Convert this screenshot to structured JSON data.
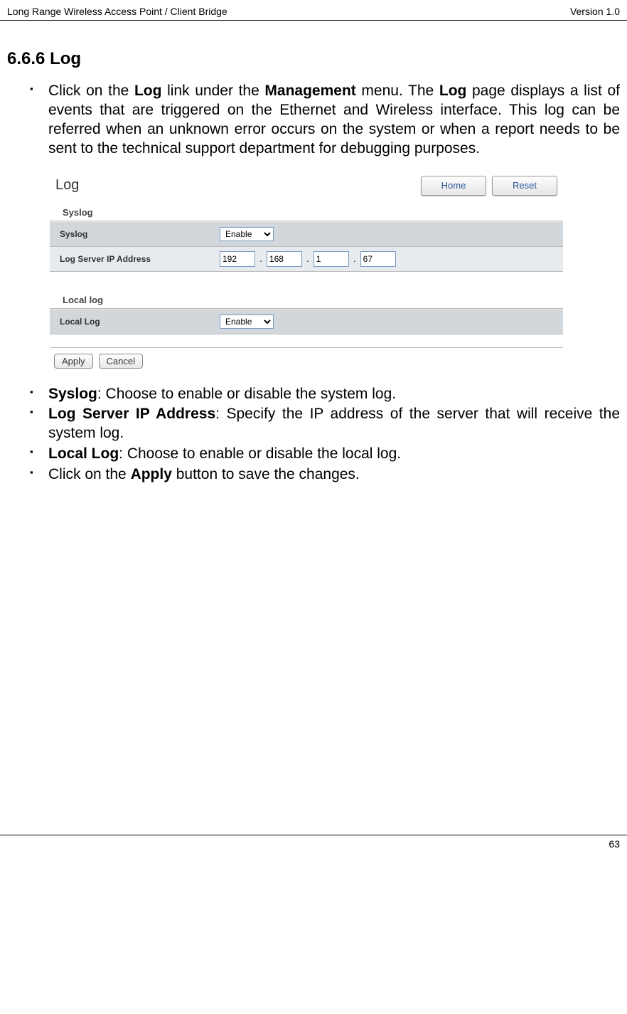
{
  "header": {
    "left": "Long Range Wireless Access Point / Client Bridge",
    "right": "Version 1.0"
  },
  "section": {
    "number": "6.6.6",
    "title": "Log"
  },
  "intro": {
    "prefix": "Click on the ",
    "bold1": "Log",
    "mid1": " link under the ",
    "bold2": "Management",
    "mid2": " menu. The ",
    "bold3": "Log",
    "suffix": " page displays a list of events that are triggered on the Ethernet and Wireless interface. This log can be referred when an unknown error occurs on the system or when a report needs to be sent to the technical support department for debugging purposes."
  },
  "screenshot": {
    "title": "Log",
    "home_btn": "Home",
    "reset_btn": "Reset",
    "syslog_section": "Syslog",
    "syslog_label": "Syslog",
    "syslog_value": "Enable",
    "ip_label": "Log Server IP Address",
    "ip": {
      "a": "192",
      "b": "168",
      "c": "1",
      "d": "67"
    },
    "local_section": "Local log",
    "local_label": "Local Log",
    "local_value": "Enable",
    "apply_btn": "Apply",
    "cancel_btn": "Cancel"
  },
  "bullets": {
    "b1_bold": "Syslog",
    "b1_text": ": Choose to enable or disable the system log.",
    "b2_bold": "Log Server IP Address",
    "b2_text": ": Specify the IP address of the server that will receive the system log.",
    "b3_bold": "Local Log",
    "b3_text": ": Choose to enable or disable the local log.",
    "b4_pre": "Click on the ",
    "b4_bold": "Apply",
    "b4_post": " button to save the changes."
  },
  "footer": {
    "page": "63"
  }
}
